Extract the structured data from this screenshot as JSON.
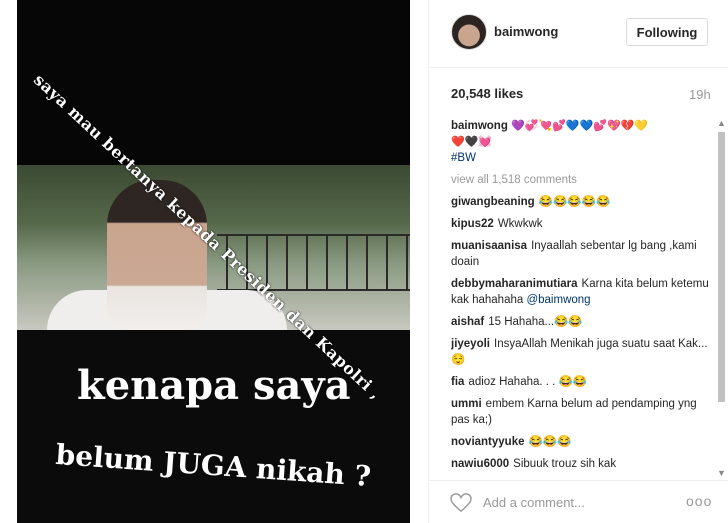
{
  "photo": {
    "diagonal_text": "saya mau bertanya kepada Presiden dan Kapolri ,",
    "headline_line1": "kenapa saya",
    "headline_line2": "belum JUGA nikah ?"
  },
  "header": {
    "username": "baimwong",
    "follow_label": "Following"
  },
  "stats": {
    "likes": "20,548 likes",
    "time": "19h"
  },
  "caption": {
    "user": "baimwong",
    "emojis_line1": "💜💞💘💕💙💙💕💖💔💛",
    "emojis_line2": "❤️🖤💓",
    "hashtag": "#BW"
  },
  "view_all": "view all 1,518 comments",
  "comments": [
    {
      "user": "giwangbeaning",
      "text": "😂😂😂😂😂"
    },
    {
      "user": "kipus22",
      "text": "Wkwkwk"
    },
    {
      "user": "muanisaanisa",
      "text": "Inyaallah sebentar lg bang ,kami doain"
    },
    {
      "user": "debbymaharanimutiara",
      "text": "Karna kita belum ketemu kak hahahaha",
      "mention": "@baimwong"
    },
    {
      "user": "aishaf",
      "text": "15 Hahaha...😂😂"
    },
    {
      "user": "jiyeyoli",
      "text": "InsyaAllah Menikah juga suatu saat Kak...😌"
    },
    {
      "user": "fia",
      "text": "adioz Hahaha. . . 😂😂"
    },
    {
      "user": "ummi",
      "text": "embem Karna belum ad pendamping yng pas ka;)"
    },
    {
      "user": "noviantyyuke",
      "text": "😂😂😂"
    },
    {
      "user": "nawiu6000",
      "text": "Sibuuk trouz sih kak"
    }
  ],
  "comment_bar": {
    "placeholder": "Add a comment...",
    "more": "ooo"
  }
}
